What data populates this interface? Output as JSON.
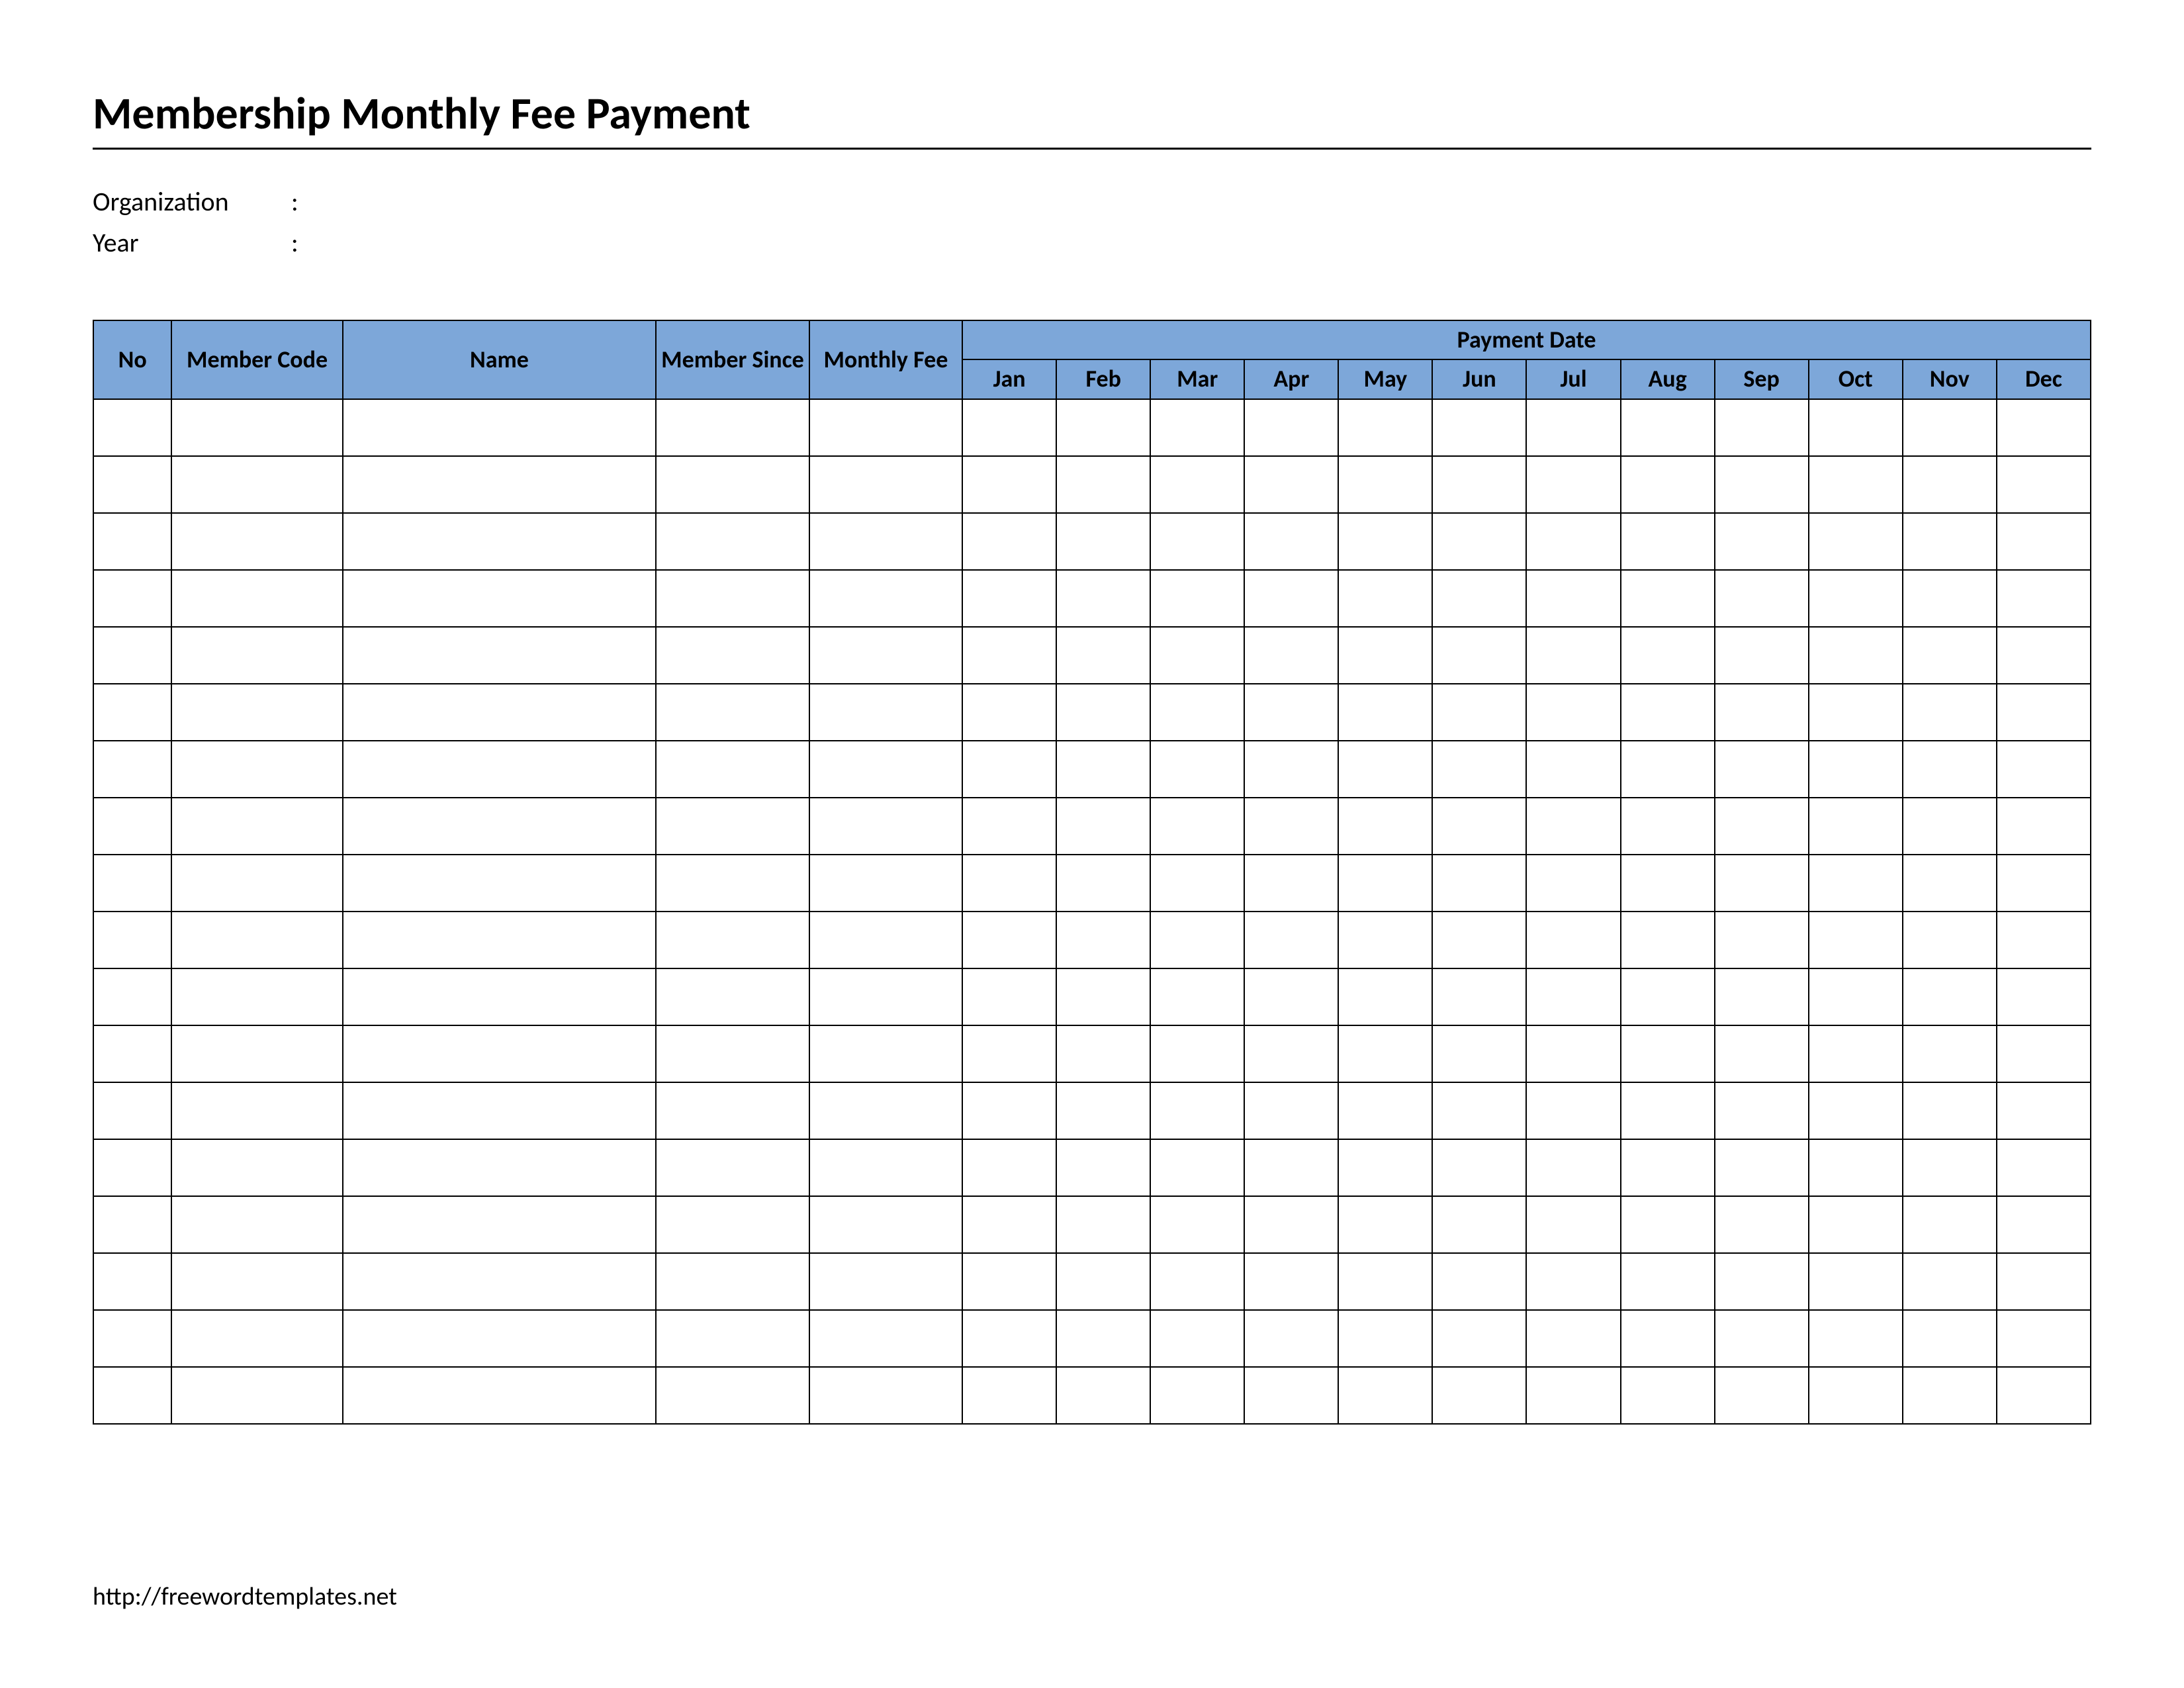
{
  "title": "Membership Monthly Fee Payment",
  "meta": {
    "organization_label": "Organization",
    "year_label": "Year",
    "colon": ":",
    "organization_value": "",
    "year_value": ""
  },
  "table": {
    "headers": {
      "no": "No",
      "member_code": "Member Code",
      "name": "Name",
      "member_since": "Member Since",
      "monthly_fee": "Monthly Fee",
      "payment_date": "Payment Date"
    },
    "months": [
      "Jan",
      "Feb",
      "Mar",
      "Apr",
      "May",
      "Jun",
      "Jul",
      "Aug",
      "Sep",
      "Oct",
      "Nov",
      "Dec"
    ],
    "row_count": 18
  },
  "footer": "http://freewordtemplates.net"
}
